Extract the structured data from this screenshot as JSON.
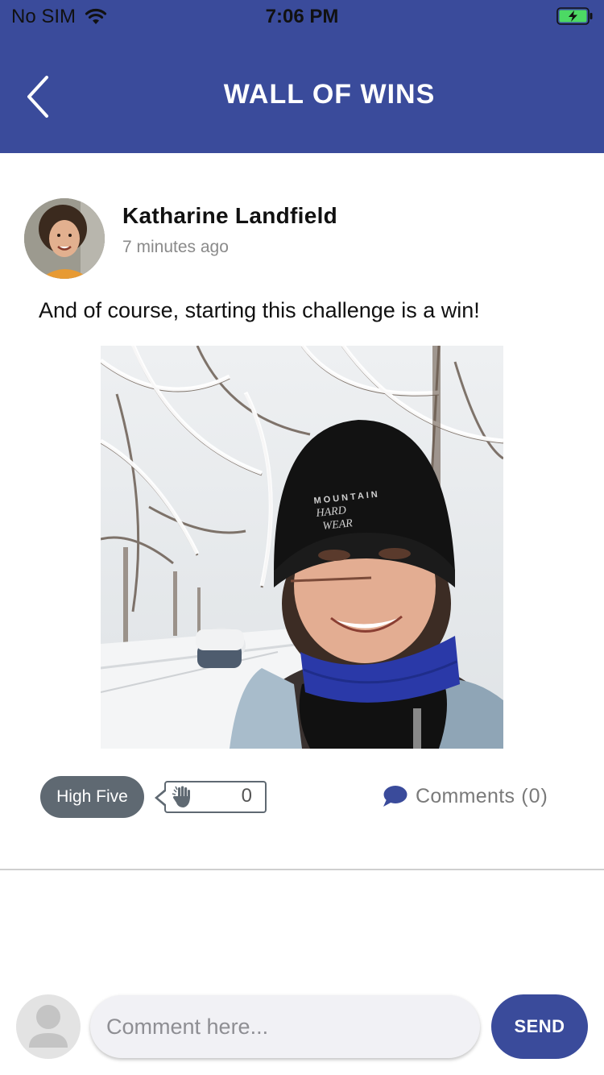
{
  "status_bar": {
    "carrier": "No SIM",
    "time": "7:06 PM",
    "wifi_icon": "wifi-icon",
    "battery_icon": "battery-charging-icon",
    "battery_color": "#4cd964"
  },
  "header": {
    "title": "WALL OF WINS",
    "back_icon": "chevron-left-icon",
    "background": "#3a4b9b"
  },
  "post": {
    "author": "Katharine Landfield",
    "time_ago": "7 minutes ago",
    "text": "And of course, starting this challenge is a win!",
    "hat_text_line1": "MOUNTAIN",
    "hat_text_line2": "HARD",
    "hat_text_line3": "WEAR",
    "high_five_label": "High Five",
    "high_five_icon": "high-five-hand-icon",
    "high_five_count": "0",
    "comments_icon": "speech-bubble-icon",
    "comments_label": "Comments",
    "comments_count": "(0)"
  },
  "composer": {
    "avatar_icon": "user-placeholder-icon",
    "placeholder": "Comment here...",
    "send_label": "SEND"
  }
}
